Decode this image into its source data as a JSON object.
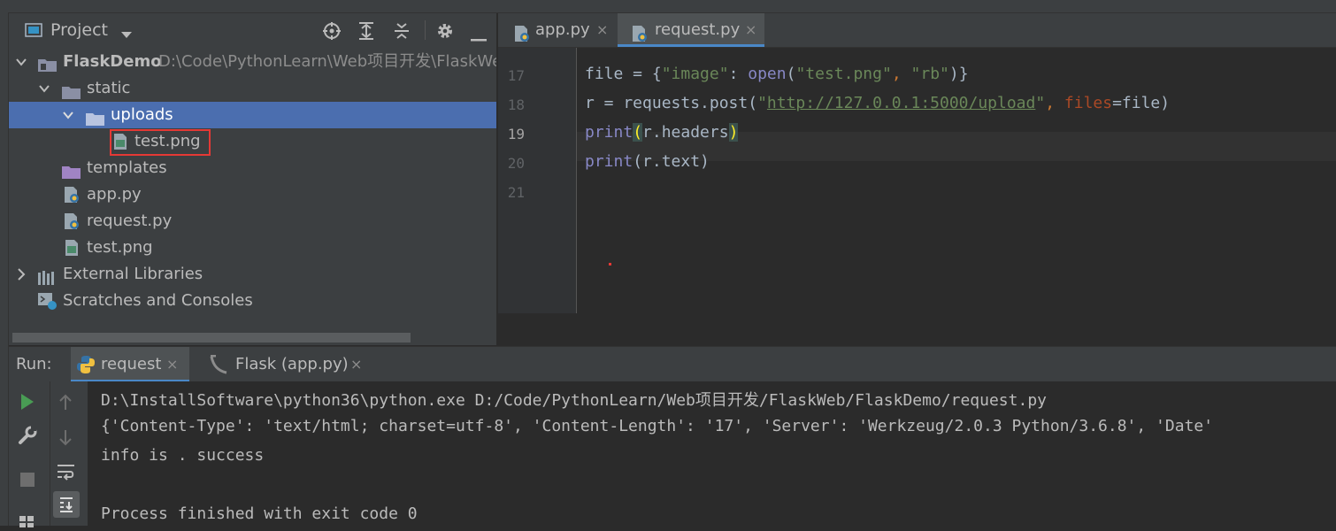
{
  "project_panel": {
    "title": "Project",
    "root": {
      "name": "FlaskDemo",
      "path": "D:\\Code\\PythonLearn\\Web项目开发\\FlaskWe"
    },
    "items": [
      {
        "label": "static"
      },
      {
        "label": "uploads"
      },
      {
        "label": "test.png"
      },
      {
        "label": "templates"
      },
      {
        "label": "app.py"
      },
      {
        "label": "request.py"
      },
      {
        "label": "test.png"
      },
      {
        "label": "External Libraries"
      },
      {
        "label": "Scratches and Consoles"
      }
    ]
  },
  "editor": {
    "tabs": [
      {
        "label": "app.py",
        "active": false
      },
      {
        "label": "request.py",
        "active": true
      }
    ],
    "line_numbers": [
      "17",
      "18",
      "19",
      "20",
      "21"
    ],
    "lines": {
      "l17": {
        "a": "file = {",
        "b": "\"image\"",
        "c": ": ",
        "d": "open",
        "e": "(",
        "f": "\"test.png\"",
        "g": ", ",
        "h": "\"rb\"",
        "i": ")}"
      },
      "l18": {
        "a": "r = requests.post(",
        "b": "\"",
        "c": "http://127.0.0.1:5000/upload",
        "d": "\"",
        "e": ", ",
        "f": "files",
        "g": "=file)"
      },
      "l19": {
        "a": "print",
        "b": "(",
        "c": "r.headers",
        "d": ")"
      },
      "l20": {
        "a": "print",
        "b": "(r.text)"
      }
    }
  },
  "run": {
    "label": "Run:",
    "tabs": [
      {
        "label": "request",
        "active": true
      },
      {
        "label": "Flask (app.py)",
        "active": false
      }
    ],
    "output": [
      "D:\\InstallSoftware\\python36\\python.exe D:/Code/PythonLearn/Web项目开发/FlaskWeb/FlaskDemo/request.py",
      "{'Content-Type': 'text/html; charset=utf-8', 'Content-Length': '17', 'Server': 'Werkzeug/2.0.3 Python/3.6.8', 'Date'",
      "info is . success",
      "",
      "Process finished with exit code 0"
    ]
  },
  "colors": {
    "selection": "#4b6eaf",
    "folder": "#8a8fa4",
    "keyword_builtin": "#8888c6",
    "string": "#6a8759",
    "param": "#aa4926",
    "link": "#287bde",
    "highlight_box": "#e53935"
  }
}
